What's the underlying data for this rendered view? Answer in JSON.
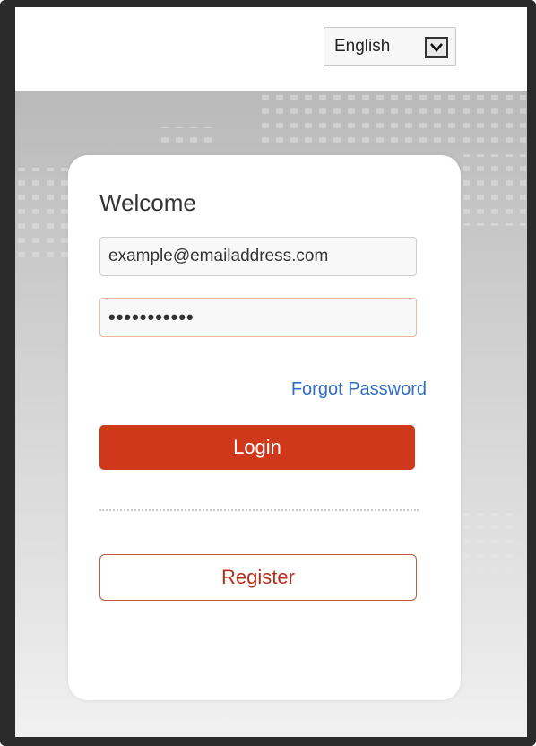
{
  "language": {
    "selected": "English"
  },
  "login_form": {
    "heading": "Welcome",
    "email_value": "example@emailaddress.com",
    "password_masked": "•••••••••••",
    "forgot_password": "Forgot Password",
    "login_label": "Login",
    "register_label": "Register"
  },
  "colors": {
    "primary": "#d0381b",
    "link": "#2f6ec3",
    "register_text": "#b5301c"
  },
  "icons": {
    "language_dropdown": "chevron-down-icon"
  }
}
